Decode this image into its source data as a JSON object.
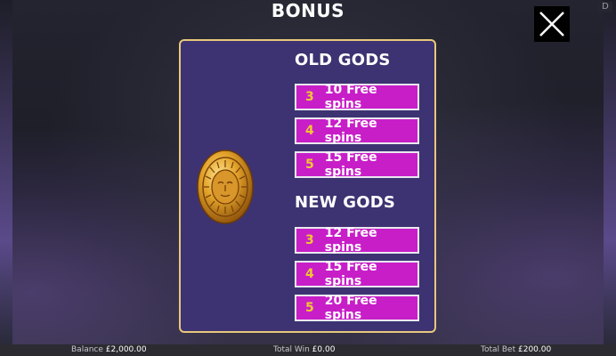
{
  "header": {
    "title": "BONUS",
    "corner_label": "D"
  },
  "panel": {
    "sections": [
      {
        "title": "OLD GODS",
        "rows": [
          {
            "count": "3",
            "spins": "10 Free spins"
          },
          {
            "count": "4",
            "spins": "12 Free spins"
          },
          {
            "count": "5",
            "spins": "15 Free spins"
          }
        ]
      },
      {
        "title": "NEW GODS",
        "rows": [
          {
            "count": "3",
            "spins": "12 Free spins"
          },
          {
            "count": "4",
            "spins": "15 Free spins"
          },
          {
            "count": "5",
            "spins": "20 Free spins"
          }
        ]
      }
    ],
    "symbol_icon": "golden-sun-coin-icon"
  },
  "footer": {
    "balance_label": "Balance",
    "balance_value": "£2,000.00",
    "win_label": "Total Win",
    "win_value": "£0.00",
    "bet_label": "Total Bet",
    "bet_value": "£200.00"
  },
  "colors": {
    "panel_bg": "#3d3372",
    "panel_border": "#e8c87a",
    "row_bg": "#c81ec8",
    "count_color": "#f0c830"
  }
}
